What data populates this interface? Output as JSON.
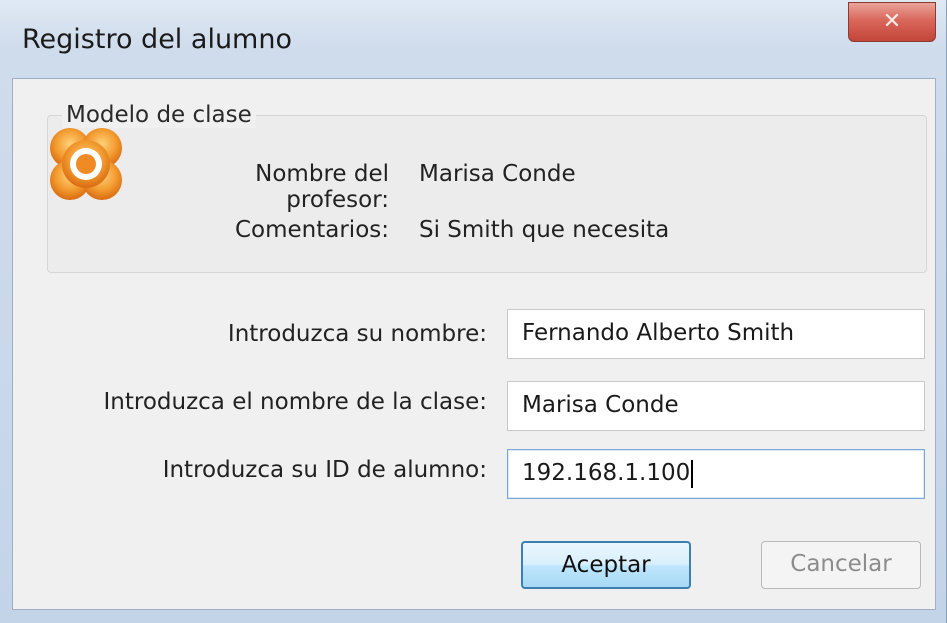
{
  "window": {
    "title": "Registro del alumno",
    "close_symbol": "✕"
  },
  "class_model": {
    "legend": "Modelo de clase",
    "icon": "app-logo-icon",
    "teacher_label": "Nombre del profesor:",
    "teacher_value": "Marisa Conde",
    "comments_label": "Comentarios:",
    "comments_value": "Si Smith que necesita"
  },
  "form": {
    "name_label": "Introduzca su nombre:",
    "name_value": "Fernando Alberto Smith",
    "class_label": "Introduzca el nombre de la clase:",
    "class_value": "Marisa Conde",
    "id_label": "Introduzca su ID de alumno:",
    "id_value": "192.168.1.100"
  },
  "buttons": {
    "accept": "Aceptar",
    "cancel": "Cancelar"
  },
  "colors": {
    "logo_orange": "#f08a24",
    "close_red": "#d9675a",
    "accent_blue": "#3c7fb1"
  }
}
